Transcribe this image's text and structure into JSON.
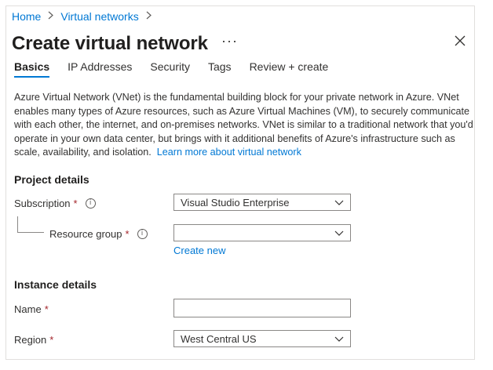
{
  "breadcrumb": {
    "items": [
      "Home",
      "Virtual networks"
    ]
  },
  "header": {
    "title": "Create virtual network",
    "more_label": "···"
  },
  "tabs": [
    {
      "label": "Basics",
      "active": true
    },
    {
      "label": "IP Addresses",
      "active": false
    },
    {
      "label": "Security",
      "active": false
    },
    {
      "label": "Tags",
      "active": false
    },
    {
      "label": "Review + create",
      "active": false
    }
  ],
  "description": {
    "text": "Azure Virtual Network (VNet) is the fundamental building block for your private network in Azure. VNet enables many types of Azure resources, such as Azure Virtual Machines (VM), to securely communicate with each other, the internet, and on-premises networks. VNet is similar to a traditional network that you'd operate in your own data center, but brings with it additional benefits of Azure's infrastructure such as scale, availability, and isolation.",
    "link": "Learn more about virtual network"
  },
  "project_details": {
    "heading": "Project details",
    "subscription": {
      "label": "Subscription",
      "required": "*",
      "value": "Visual Studio Enterprise"
    },
    "resource_group": {
      "label": "Resource group",
      "required": "*",
      "value": "",
      "create_new": "Create new"
    }
  },
  "instance_details": {
    "heading": "Instance details",
    "name": {
      "label": "Name",
      "required": "*",
      "value": ""
    },
    "region": {
      "label": "Region",
      "required": "*",
      "value": "West Central US"
    }
  },
  "colors": {
    "accent": "#0078d4",
    "required": "#a4262c",
    "border": "#8a8886"
  },
  "icons": {
    "info": "info-icon",
    "chevron": "chevron-down-icon",
    "close": "close-icon",
    "breadcrumb_sep": "chevron-right-icon"
  }
}
